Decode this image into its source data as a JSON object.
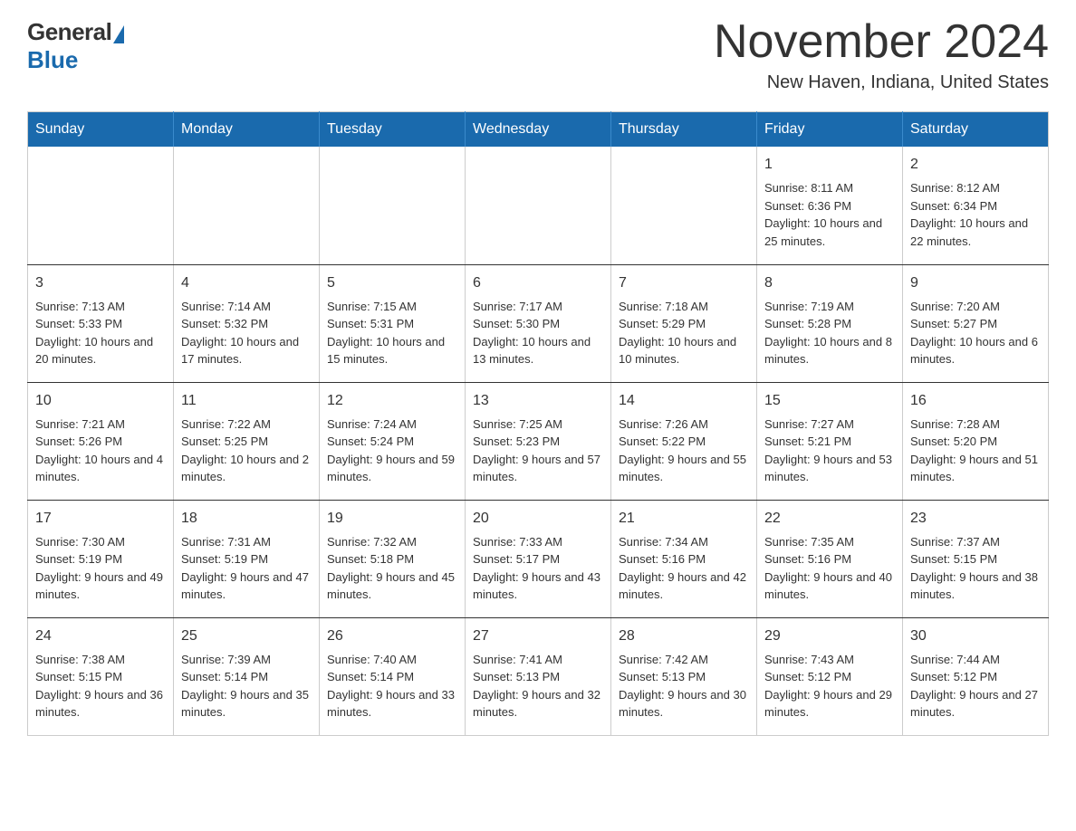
{
  "logo": {
    "general": "General",
    "blue": "Blue"
  },
  "title": "November 2024",
  "location": "New Haven, Indiana, United States",
  "days_of_week": [
    "Sunday",
    "Monday",
    "Tuesday",
    "Wednesday",
    "Thursday",
    "Friday",
    "Saturday"
  ],
  "weeks": [
    [
      {
        "day": "",
        "info": ""
      },
      {
        "day": "",
        "info": ""
      },
      {
        "day": "",
        "info": ""
      },
      {
        "day": "",
        "info": ""
      },
      {
        "day": "",
        "info": ""
      },
      {
        "day": "1",
        "info": "Sunrise: 8:11 AM\nSunset: 6:36 PM\nDaylight: 10 hours and 25 minutes."
      },
      {
        "day": "2",
        "info": "Sunrise: 8:12 AM\nSunset: 6:34 PM\nDaylight: 10 hours and 22 minutes."
      }
    ],
    [
      {
        "day": "3",
        "info": "Sunrise: 7:13 AM\nSunset: 5:33 PM\nDaylight: 10 hours and 20 minutes."
      },
      {
        "day": "4",
        "info": "Sunrise: 7:14 AM\nSunset: 5:32 PM\nDaylight: 10 hours and 17 minutes."
      },
      {
        "day": "5",
        "info": "Sunrise: 7:15 AM\nSunset: 5:31 PM\nDaylight: 10 hours and 15 minutes."
      },
      {
        "day": "6",
        "info": "Sunrise: 7:17 AM\nSunset: 5:30 PM\nDaylight: 10 hours and 13 minutes."
      },
      {
        "day": "7",
        "info": "Sunrise: 7:18 AM\nSunset: 5:29 PM\nDaylight: 10 hours and 10 minutes."
      },
      {
        "day": "8",
        "info": "Sunrise: 7:19 AM\nSunset: 5:28 PM\nDaylight: 10 hours and 8 minutes."
      },
      {
        "day": "9",
        "info": "Sunrise: 7:20 AM\nSunset: 5:27 PM\nDaylight: 10 hours and 6 minutes."
      }
    ],
    [
      {
        "day": "10",
        "info": "Sunrise: 7:21 AM\nSunset: 5:26 PM\nDaylight: 10 hours and 4 minutes."
      },
      {
        "day": "11",
        "info": "Sunrise: 7:22 AM\nSunset: 5:25 PM\nDaylight: 10 hours and 2 minutes."
      },
      {
        "day": "12",
        "info": "Sunrise: 7:24 AM\nSunset: 5:24 PM\nDaylight: 9 hours and 59 minutes."
      },
      {
        "day": "13",
        "info": "Sunrise: 7:25 AM\nSunset: 5:23 PM\nDaylight: 9 hours and 57 minutes."
      },
      {
        "day": "14",
        "info": "Sunrise: 7:26 AM\nSunset: 5:22 PM\nDaylight: 9 hours and 55 minutes."
      },
      {
        "day": "15",
        "info": "Sunrise: 7:27 AM\nSunset: 5:21 PM\nDaylight: 9 hours and 53 minutes."
      },
      {
        "day": "16",
        "info": "Sunrise: 7:28 AM\nSunset: 5:20 PM\nDaylight: 9 hours and 51 minutes."
      }
    ],
    [
      {
        "day": "17",
        "info": "Sunrise: 7:30 AM\nSunset: 5:19 PM\nDaylight: 9 hours and 49 minutes."
      },
      {
        "day": "18",
        "info": "Sunrise: 7:31 AM\nSunset: 5:19 PM\nDaylight: 9 hours and 47 minutes."
      },
      {
        "day": "19",
        "info": "Sunrise: 7:32 AM\nSunset: 5:18 PM\nDaylight: 9 hours and 45 minutes."
      },
      {
        "day": "20",
        "info": "Sunrise: 7:33 AM\nSunset: 5:17 PM\nDaylight: 9 hours and 43 minutes."
      },
      {
        "day": "21",
        "info": "Sunrise: 7:34 AM\nSunset: 5:16 PM\nDaylight: 9 hours and 42 minutes."
      },
      {
        "day": "22",
        "info": "Sunrise: 7:35 AM\nSunset: 5:16 PM\nDaylight: 9 hours and 40 minutes."
      },
      {
        "day": "23",
        "info": "Sunrise: 7:37 AM\nSunset: 5:15 PM\nDaylight: 9 hours and 38 minutes."
      }
    ],
    [
      {
        "day": "24",
        "info": "Sunrise: 7:38 AM\nSunset: 5:15 PM\nDaylight: 9 hours and 36 minutes."
      },
      {
        "day": "25",
        "info": "Sunrise: 7:39 AM\nSunset: 5:14 PM\nDaylight: 9 hours and 35 minutes."
      },
      {
        "day": "26",
        "info": "Sunrise: 7:40 AM\nSunset: 5:14 PM\nDaylight: 9 hours and 33 minutes."
      },
      {
        "day": "27",
        "info": "Sunrise: 7:41 AM\nSunset: 5:13 PM\nDaylight: 9 hours and 32 minutes."
      },
      {
        "day": "28",
        "info": "Sunrise: 7:42 AM\nSunset: 5:13 PM\nDaylight: 9 hours and 30 minutes."
      },
      {
        "day": "29",
        "info": "Sunrise: 7:43 AM\nSunset: 5:12 PM\nDaylight: 9 hours and 29 minutes."
      },
      {
        "day": "30",
        "info": "Sunrise: 7:44 AM\nSunset: 5:12 PM\nDaylight: 9 hours and 27 minutes."
      }
    ]
  ]
}
